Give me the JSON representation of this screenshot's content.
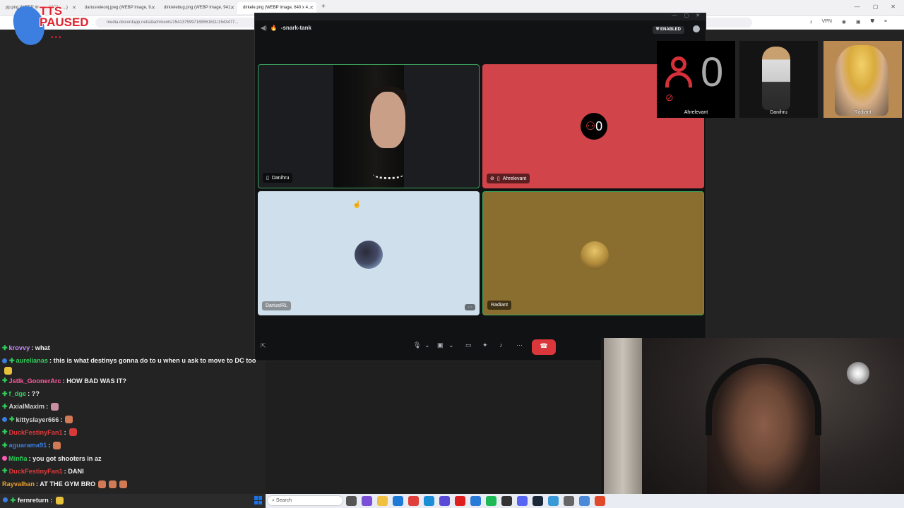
{
  "browser": {
    "tabs": [
      {
        "label": "pp.png (WEBP Image, 1000 x ...)",
        "active": false
      },
      {
        "label": "dariusreleonj.jpeg (WEBP Image, 9...",
        "active": false
      },
      {
        "label": "dirkrelebug.png (WEBP Image, 941...",
        "active": false
      },
      {
        "label": "dirkele.png (WEBP Image, 640 x 4...",
        "active": true
      }
    ],
    "url": "media.discordapp.net/attachments/1541375997169561611/1543477...",
    "vpn_label": "VPN"
  },
  "overlay": {
    "tts_text": "TTS\nPAUSED",
    "tts_dots": "•••"
  },
  "discord": {
    "channel": "-snark-tank",
    "enabled_badge": "ENABLED",
    "tiles": [
      {
        "name": "Danihru",
        "muted": false
      },
      {
        "name": "Ahrelevant",
        "muted": true,
        "avatar_count": "0"
      },
      {
        "name": "DariusIRL",
        "muted": false
      },
      {
        "name": "Radiant",
        "muted": false
      }
    ]
  },
  "thumbnails": [
    {
      "label": "Ahrelevant",
      "count": "0"
    },
    {
      "label": "Danihru"
    },
    {
      "label": "Radiant"
    }
  ],
  "chat": {
    "messages": [
      {
        "user": "krovvy",
        "color": "#c58af9",
        "text": ": what",
        "badges": [
          "g"
        ]
      },
      {
        "user": "aurelianas",
        "color": "#2fcf5b",
        "text": ": this is what destinys gonna do to u when u ask to move to DC too",
        "badges": [
          "b",
          "g"
        ]
      },
      {
        "user": "Jstlk_GoonerArc",
        "color": "#ff5aa0",
        "text": ": HOW BAD WAS IT?",
        "badges": [
          "g"
        ]
      },
      {
        "user": "f_dge",
        "color": "#2fcf5b",
        "text": ": ??",
        "badges": [
          "g"
        ]
      },
      {
        "user": "AxialMaxim",
        "color": "#d0d0d0",
        "text": ":",
        "badges": [
          "g"
        ],
        "emote": "p"
      },
      {
        "user": "kittyslayer666",
        "color": "#d0d0d0",
        "text": ":",
        "badges": [
          "b",
          "g"
        ],
        "emote": ""
      },
      {
        "user": "DuckFestinyFan1",
        "color": "#e23a3a",
        "text": ":",
        "badges": [
          "g"
        ],
        "emote": "r"
      },
      {
        "user": "aguarama91",
        "color": "#3b7ee0",
        "text": ":",
        "badges": [
          "g"
        ],
        "emote": ""
      },
      {
        "user": "Minfia",
        "color": "#2fcf5b",
        "text": ": you got shooters in az",
        "badges": [
          "p"
        ]
      },
      {
        "user": "DuckFestinyFan1",
        "color": "#e23a3a",
        "text": ": DANI",
        "badges": [
          "g"
        ]
      },
      {
        "user": "Rayvalhan",
        "color": "#e8a030",
        "text": ": AT THE GYM BRO",
        "badges": [],
        "emote": "triple"
      }
    ],
    "last_line": "fernreturn :"
  },
  "taskbar": {
    "search_placeholder": "Search"
  }
}
